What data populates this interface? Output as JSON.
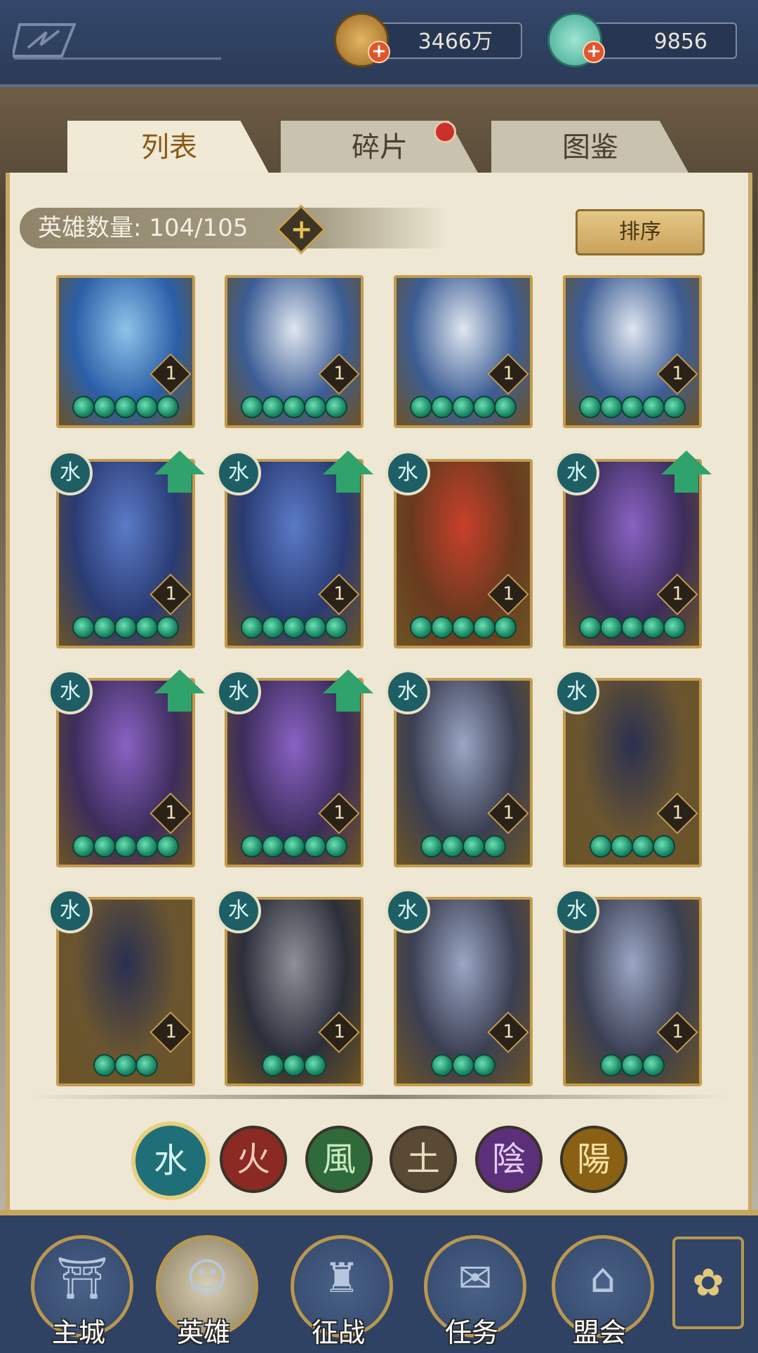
{
  "currency": {
    "coins": "3466万",
    "jade": "9856"
  },
  "tabs": [
    {
      "label": "列表",
      "active": true
    },
    {
      "label": "碎片",
      "active": false,
      "has_notification": true
    },
    {
      "label": "图鉴",
      "active": false
    }
  ],
  "hero_count": {
    "label": "英雄数量: 104/105"
  },
  "sort_label": "排序",
  "heroes": [
    {
      "level": "1",
      "stars": 5,
      "element_badge": false,
      "upgrade": false,
      "palette": "blue"
    },
    {
      "level": "1",
      "stars": 5,
      "element_badge": false,
      "upgrade": false,
      "palette": "silver"
    },
    {
      "level": "1",
      "stars": 5,
      "element_badge": false,
      "upgrade": false,
      "palette": "silver"
    },
    {
      "level": "1",
      "stars": 5,
      "element_badge": false,
      "upgrade": false,
      "palette": "silver"
    },
    {
      "level": "1",
      "stars": 5,
      "element_badge": true,
      "upgrade": true,
      "palette": "navy"
    },
    {
      "level": "1",
      "stars": 5,
      "element_badge": true,
      "upgrade": true,
      "palette": "navy"
    },
    {
      "level": "1",
      "stars": 5,
      "element_badge": true,
      "upgrade": false,
      "palette": "red"
    },
    {
      "level": "1",
      "stars": 5,
      "element_badge": true,
      "upgrade": true,
      "palette": "purple"
    },
    {
      "level": "1",
      "stars": 5,
      "element_badge": true,
      "upgrade": true,
      "palette": "purple"
    },
    {
      "level": "1",
      "stars": 5,
      "element_badge": true,
      "upgrade": true,
      "palette": "purple"
    },
    {
      "level": "1",
      "stars": 4,
      "element_badge": true,
      "upgrade": false,
      "palette": "steel"
    },
    {
      "level": "1",
      "stars": 4,
      "element_badge": true,
      "upgrade": false,
      "palette": "gold"
    },
    {
      "level": "1",
      "stars": 3,
      "element_badge": true,
      "upgrade": false,
      "palette": "gold"
    },
    {
      "level": "1",
      "stars": 3,
      "element_badge": true,
      "upgrade": false,
      "palette": "dark"
    },
    {
      "level": "1",
      "stars": 3,
      "element_badge": true,
      "upgrade": false,
      "palette": "steel"
    },
    {
      "level": "1",
      "stars": 3,
      "element_badge": true,
      "upgrade": false,
      "palette": "steel"
    }
  ],
  "element_badge_glyph": "水",
  "element_filters": [
    {
      "glyph": "水",
      "color": "#1f6f78",
      "text_color": "#d8f6f3",
      "selected": true
    },
    {
      "glyph": "火",
      "color": "#8a2a22",
      "text_color": "#f3c9b8",
      "selected": false
    },
    {
      "glyph": "風",
      "color": "#2f6a3a",
      "text_color": "#cde9c2",
      "selected": false
    },
    {
      "glyph": "土",
      "color": "#5a4a34",
      "text_color": "#e8dcc2",
      "selected": false
    },
    {
      "glyph": "陰",
      "color": "#5c2f7a",
      "text_color": "#e2cdf3",
      "selected": false
    },
    {
      "glyph": "陽",
      "color": "#8a6014",
      "text_color": "#f7e3a8",
      "selected": false
    }
  ],
  "nav": [
    {
      "label": "主城",
      "icon": "castle-icon"
    },
    {
      "label": "英雄",
      "icon": "hero-portrait-icon",
      "active": true
    },
    {
      "label": "征战",
      "icon": "horn-icon"
    },
    {
      "label": "任务",
      "icon": "scroll-icon"
    },
    {
      "label": "盟会",
      "icon": "gate-icon"
    }
  ],
  "colors": {
    "accent_gold": "#c29b4f",
    "nav_blue": "#2f4263",
    "upgrade_green": "#2fa36b"
  }
}
